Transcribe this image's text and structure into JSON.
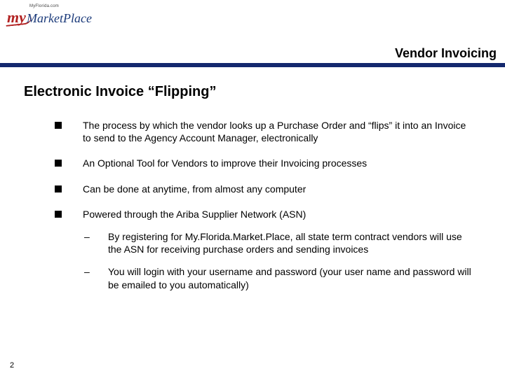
{
  "logo": {
    "small_top": "MyFlorida.com",
    "my": "my",
    "marketplace": "MarketPlace"
  },
  "header": {
    "title": "Vendor Invoicing"
  },
  "slide": {
    "title": "Electronic Invoice “Flipping”"
  },
  "bullets": [
    "The process by which the vendor looks up a Purchase Order and “flips” it into an Invoice to send to the Agency Account Manager, electronically",
    "An Optional Tool for Vendors to improve their Invoicing processes",
    "Can be done at anytime, from almost any computer",
    "Powered through the Ariba Supplier Network (ASN)"
  ],
  "subbullets": [
    "By registering for My.Florida.Market.Place, all state term contract vendors will use the ASN for receiving purchase orders and sending invoices",
    "You will login with your username and password (your user name and password will be emailed to you automatically)"
  ],
  "page_number": "2"
}
